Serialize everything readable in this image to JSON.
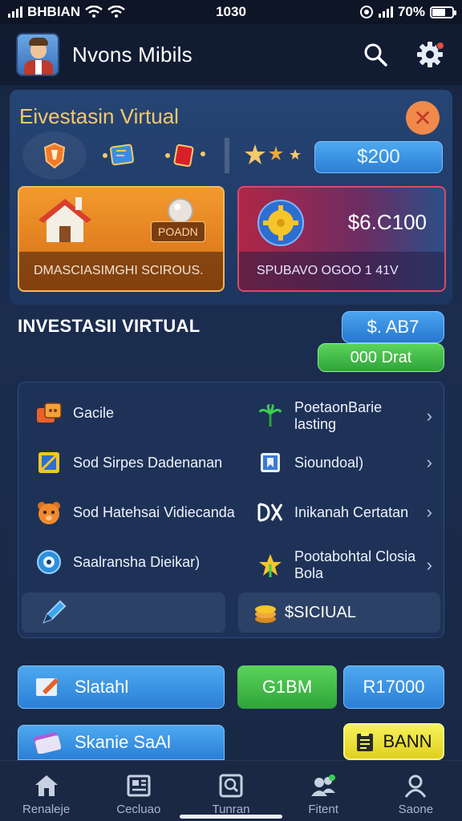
{
  "status_bar": {
    "carrier": "BHBIAN",
    "time": "1030",
    "battery": "70%",
    "battery_level": 0.7
  },
  "header": {
    "title": "Nvons Mibils"
  },
  "panel": {
    "title": "Eivestasin Virtual",
    "balance_button": "$200",
    "card_left": {
      "tag": "POADN",
      "caption": "DMASCIASIMGHI SCIROUS."
    },
    "card_right": {
      "amount": "$6.C100",
      "caption": "SPUBAVO OGOO 1 41V"
    }
  },
  "section": {
    "title": "INVESTASII VIRTUAL",
    "blue_pill": "$. AB7",
    "green_pill": "000 Drat"
  },
  "list": {
    "items": [
      {
        "label": "Gacile",
        "icon": "game-controller-icon"
      },
      {
        "label": "PoetaonBarie\nlasting",
        "icon": "palm-icon"
      },
      {
        "label": "Sod Sirpes Dadenanan",
        "icon": "pencil-frame-icon"
      },
      {
        "label": "Sioundoal)",
        "icon": "bookmark-frame-icon"
      },
      {
        "label": "Sod Hatehsai Vidiecanda",
        "icon": "bear-icon"
      },
      {
        "label": "Inikanah Certatan",
        "icon": "dk-logo-icon"
      },
      {
        "label": "Saalransha Dieikar)",
        "icon": "eye-icon"
      },
      {
        "label": "Pootabohtal Closia\nBola",
        "icon": "star-icon"
      }
    ],
    "sub_left_icon": "pen-icon",
    "sub_right_label": "$SICIUAL"
  },
  "actions": {
    "slatahl": "Slatahl",
    "green": "G1BM",
    "amount": "R17000",
    "shanie": "Skanie SaAl",
    "yellow": "BANN"
  },
  "nav": {
    "items": [
      {
        "label": "Renaleje",
        "icon": "home-icon"
      },
      {
        "label": "Cecluao",
        "icon": "news-icon"
      },
      {
        "label": "Tunran",
        "icon": "search-frame-icon"
      },
      {
        "label": "Fitent",
        "icon": "friends-icon"
      },
      {
        "label": "Saone",
        "icon": "profile-icon"
      }
    ]
  },
  "colors": {
    "accent_blue": "#2b7fd6",
    "accent_green": "#2fa33a",
    "accent_orange": "#f08a4b",
    "title_gold": "#f5c96a"
  }
}
